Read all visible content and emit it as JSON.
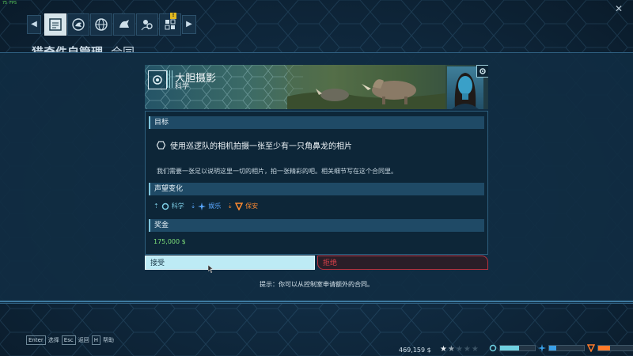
{
  "app": {
    "fps_readout": "75 FPS",
    "background_heading": "猎奇件自管理",
    "background_heading_2": "合同"
  },
  "nav": {
    "tabs": [
      "contracts-tab",
      "dinosaur-tab",
      "globe-tab",
      "dino-care-tab",
      "scientists-tab",
      "research-tab"
    ],
    "active_tab": "contracts-tab",
    "badge": "!"
  },
  "contract": {
    "title": "大胆摄影",
    "division": "科学",
    "objective_header": "目标",
    "objective_text": "使用巡逻队的相机拍摄一张至少有一只角鼻龙的相片",
    "description": "我们需要一张足以说明这里一切的相片，拍一张精彩的吧。相关细节写在这个合同里。",
    "reputation_header": "声望变化",
    "reputation": [
      {
        "label": "科学",
        "direction": "up",
        "color": "#7fd0e8"
      },
      {
        "label": "娱乐",
        "direction": "down",
        "color": "#5aa8ff"
      },
      {
        "label": "保安",
        "direction": "down",
        "color": "#ff8a30"
      }
    ],
    "reward_header": "奖金",
    "reward": "175,000 $"
  },
  "actions": {
    "accept": "接受",
    "decline": "拒绝"
  },
  "hint": "提示：你可以从控制室申请额外的合同。",
  "footer": {
    "keys": [
      {
        "key": "Enter",
        "label": "选择"
      },
      {
        "key": "Esc",
        "label": "返回"
      },
      {
        "key": "H",
        "label": "帮助"
      }
    ],
    "funds": "469,159 $",
    "rating": 1.5,
    "meters": [
      {
        "name": "science",
        "color": "#6fd0e0",
        "fill": 0.55
      },
      {
        "name": "entertainment",
        "color": "#3aa0e8",
        "fill": 0.2
      },
      {
        "name": "security",
        "color": "#ff7a2a",
        "fill": 0.35
      }
    ]
  }
}
